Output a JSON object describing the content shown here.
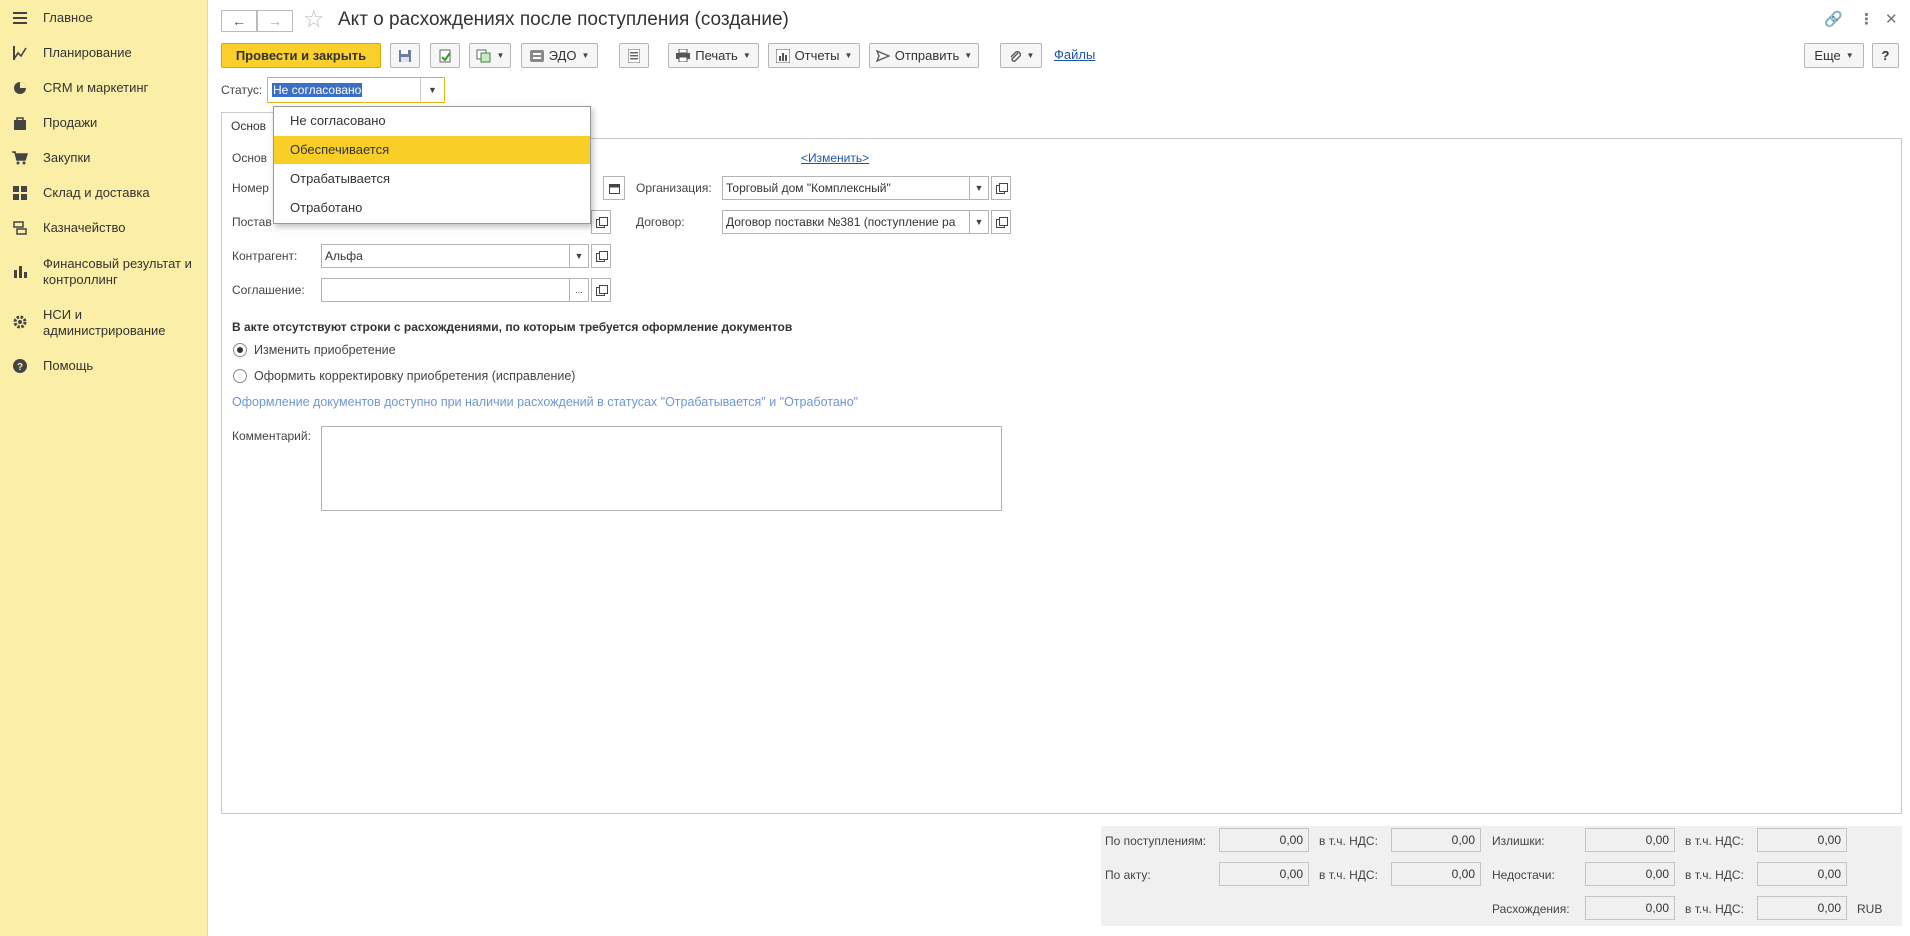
{
  "sidebar": {
    "items": [
      {
        "label": "Главное",
        "icon": "menu-icon"
      },
      {
        "label": "Планирование",
        "icon": "planning-icon"
      },
      {
        "label": "CRM и маркетинг",
        "icon": "pie-chart-icon"
      },
      {
        "label": "Продажи",
        "icon": "bag-icon"
      },
      {
        "label": "Закупки",
        "icon": "cart-icon"
      },
      {
        "label": "Склад и доставка",
        "icon": "warehouse-icon"
      },
      {
        "label": "Казначейство",
        "icon": "treasury-icon"
      },
      {
        "label": "Финансовый результат и контроллинг",
        "icon": "bar-chart-icon"
      },
      {
        "label": "НСИ и администрирование",
        "icon": "gear-icon"
      },
      {
        "label": "Помощь",
        "icon": "help-icon"
      }
    ]
  },
  "header": {
    "title": "Акт о расхождениях после поступления (создание)"
  },
  "toolbar": {
    "post_close": "Провести и закрыть",
    "edo": "ЭДО",
    "print": "Печать",
    "reports": "Отчеты",
    "send": "Отправить",
    "files": "Файлы",
    "more": "Еще",
    "help": "?"
  },
  "status": {
    "label": "Статус:",
    "value": "Не согласовано",
    "options": [
      "Не согласовано",
      "Обеспечивается",
      "Отрабатывается",
      "Отработано"
    ],
    "highlighted": "Обеспечивается"
  },
  "tab": {
    "label": "Основ"
  },
  "form": {
    "osnov_label": "Основ",
    "change_link": "<Изменить>",
    "number_label": "Номер",
    "org_label": "Организация:",
    "org_value": "Торговый дом \"Комплексный\"",
    "supplier_label": "Постав",
    "contract_label": "Договор:",
    "contract_value": "Договор поставки №381 (поступление ра",
    "counterparty_label": "Контрагент:",
    "counterparty_value": "Альфа",
    "agreement_label": "Соглашение:",
    "agreement_value": "",
    "notice": "В акте отсутствуют строки с расхождениями, по которым требуется оформление документов",
    "radio1": "Изменить приобретение",
    "radio2": "Оформить корректировку приобретения (исправление)",
    "hint": "Оформление документов доступно при наличии расхождений в статусах \"Отрабатывается\" и \"Отработано\"",
    "comment_label": "Комментарий:",
    "comment_value": ""
  },
  "totals": {
    "receipts_label": "По поступлениям:",
    "receipts": "0,00",
    "receipts_vat": "0,00",
    "act_label": "По акту:",
    "act": "0,00",
    "act_vat": "0,00",
    "vat_label": "в т.ч. НДС:",
    "surplus_label": "Излишки:",
    "surplus": "0,00",
    "surplus_vat": "0,00",
    "shortage_label": "Недостачи:",
    "shortage": "0,00",
    "shortage_vat": "0,00",
    "discrepancy_label": "Расхождения:",
    "discrepancy": "0,00",
    "discrepancy_vat": "0,00",
    "currency": "RUB"
  }
}
